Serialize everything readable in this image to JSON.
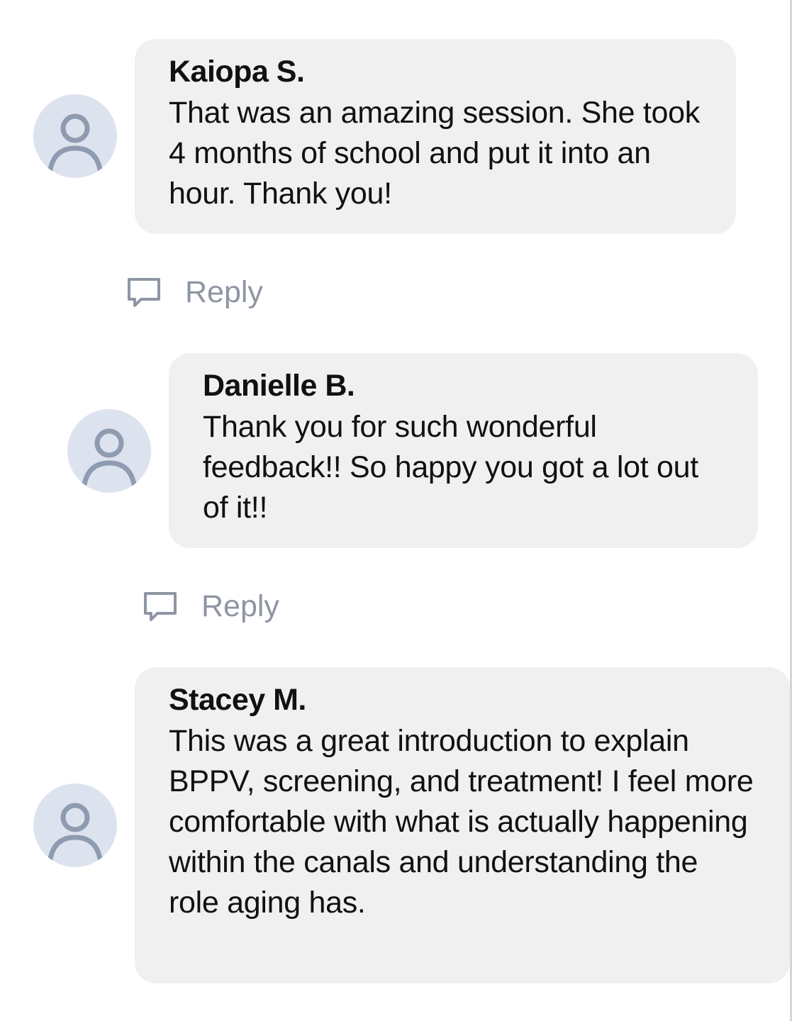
{
  "comments": [
    {
      "author": "Kaiopa S.",
      "text": "That was an amazing session. She took 4 months of school and put it into an hour. Thank you!",
      "reply_label": "Reply",
      "avatar_icon": "user-avatar-icon"
    },
    {
      "author": "Danielle B.",
      "text": "Thank you for such wonderful feedback!! So happy you got a lot out of it!!",
      "reply_label": "Reply",
      "avatar_icon": "user-avatar-icon"
    },
    {
      "author": "Stacey M.",
      "text": "This was a great introduction to explain BPPV, screening, and treatment! I feel more comfortable with what is actually happening within the canals and understanding the role aging has.",
      "avatar_icon": "user-avatar-icon"
    }
  ],
  "colors": {
    "bubble_background": "#f0f0f0",
    "avatar_background": "#dde3ee",
    "avatar_glyph": "#8e9bb0",
    "reply_text": "#8e96a3"
  }
}
